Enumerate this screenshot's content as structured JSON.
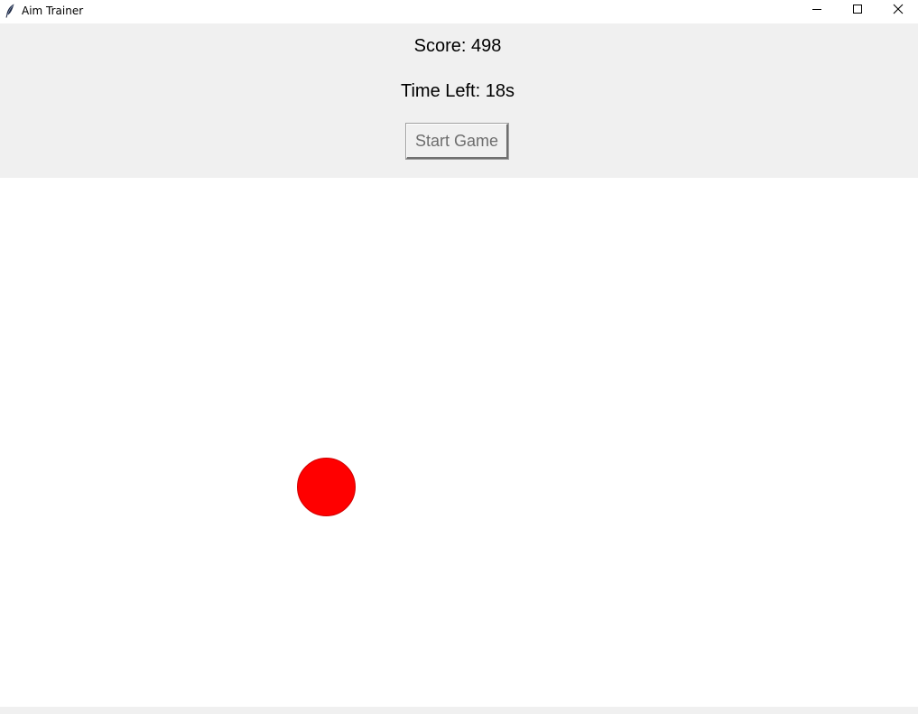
{
  "window": {
    "title": "Aim Trainer",
    "icon": "feather-icon"
  },
  "panel": {
    "score_text": "Score: 498",
    "time_text": "Time Left: 18s",
    "start_button_label": "Start Game"
  },
  "canvas": {
    "target_color": "#ff0000",
    "background": "#ffffff"
  },
  "colors": {
    "panel_bg": "#f0f0f0",
    "button_text_disabled": "#6d6d6d"
  }
}
